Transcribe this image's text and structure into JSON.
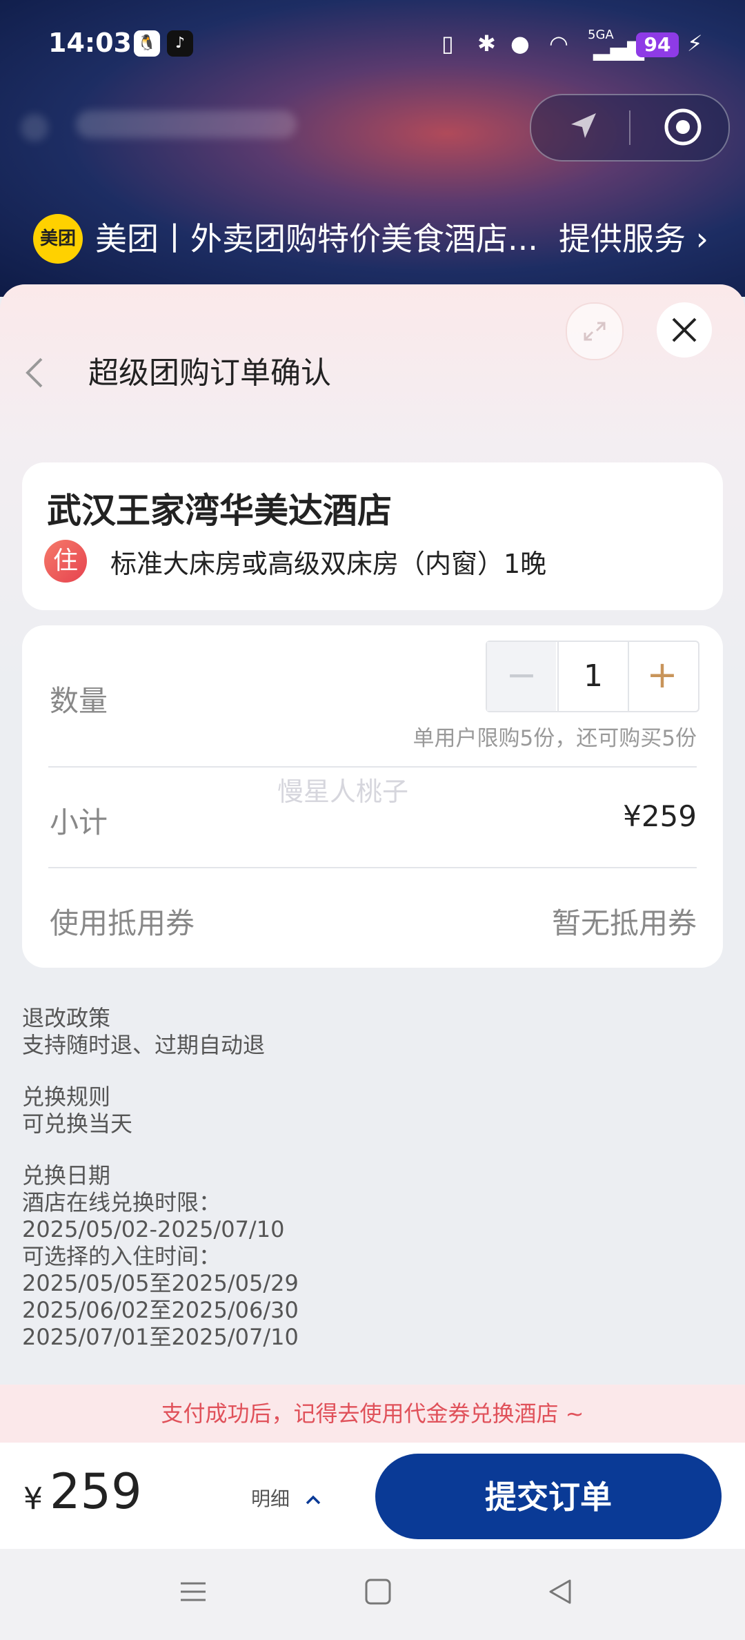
{
  "status_bar": {
    "time": "14:03",
    "battery": "94",
    "network": "5GA"
  },
  "miniprogram": {
    "logo_text": "美团",
    "title": "美团丨外卖团购特价美食酒店...",
    "service_link": "提供服务"
  },
  "sheet": {
    "nav_title": "超级团购订单确认"
  },
  "hotel": {
    "name": "武汉王家湾华美达酒店",
    "badge": "住",
    "room": "标准大床房或高级双床房（内窗）1晚"
  },
  "order": {
    "quantity_label": "数量",
    "quantity_value": "1",
    "minus": "−",
    "plus": "+",
    "limit_note": "单用户限购5份，还可购买5份",
    "watermark": "慢星人桃子",
    "subtotal_label": "小计",
    "subtotal_value": "¥259",
    "coupon_label": "使用抵用券",
    "coupon_value": "暂无抵用券"
  },
  "policies": [
    {
      "title": "退改政策",
      "body": "支持随时退、过期自动退"
    },
    {
      "title": "兑换规则",
      "body": "可兑换当天"
    },
    {
      "title": "兑换日期",
      "body": "酒店在线兑换时限：\n2025/05/02-2025/07/10\n可选择的入住时间：\n2025/05/05至2025/05/29\n2025/06/02至2025/06/30\n2025/07/01至2025/07/10"
    }
  ],
  "notice": "支付成功后，记得去使用代金券兑换酒店 ~",
  "bottom_bar": {
    "currency": "¥",
    "price": "259",
    "detail": "明细",
    "submit": "提交订单"
  },
  "colors": {
    "primary": "#0a3a96",
    "notice_red": "#e0515a",
    "accent_orange": "#c8945a"
  }
}
